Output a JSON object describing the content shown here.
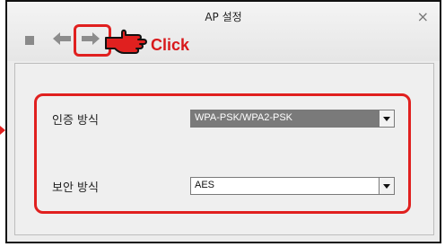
{
  "window": {
    "title": "AP 설정",
    "close_glyph": "×"
  },
  "toolbar": {
    "icons": [
      "stop-icon",
      "back-arrow-icon",
      "forward-arrow-icon"
    ],
    "callout_text": "Click",
    "highlight_color": "#e0201f"
  },
  "settings": {
    "auth_label": "인증 방식",
    "auth_value": "WPA-PSK/WPA2-PSK",
    "security_label": "보안 방식",
    "security_value": "AES"
  }
}
